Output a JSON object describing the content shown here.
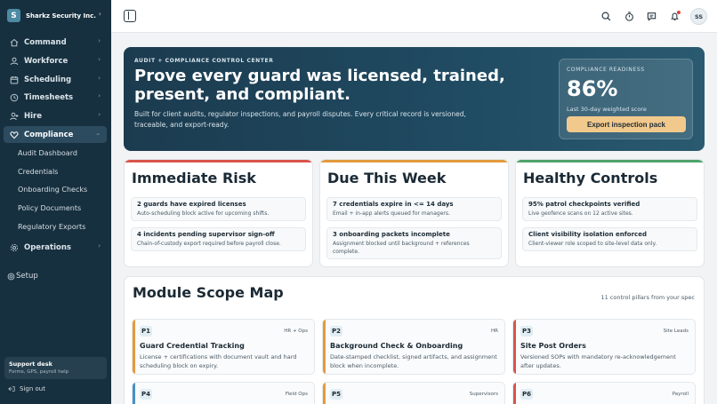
{
  "sidebar": {
    "brand_initial": "S",
    "brand_name": "Sharkz Security Inc.",
    "items": [
      {
        "label": "Command",
        "icon": "home-icon"
      },
      {
        "label": "Workforce",
        "icon": "users-icon"
      },
      {
        "label": "Scheduling",
        "icon": "calendar-icon"
      },
      {
        "label": "Timesheets",
        "icon": "clock-icon"
      },
      {
        "label": "Hire",
        "icon": "user-plus-icon"
      },
      {
        "label": "Compliance",
        "icon": "heart-icon"
      }
    ],
    "compliance_subitems": [
      "Audit Dashboard",
      "Credentials",
      "Onboarding Checks",
      "Policy Documents",
      "Regulatory Exports"
    ],
    "operations_label": "Operations",
    "setup_label": "Setup",
    "support_title": "Support desk",
    "support_sub": "Forms, GPS, payroll help",
    "signout_label": "Sign out"
  },
  "topbar": {
    "avatar_initials": "SS",
    "icons": [
      "search-icon",
      "timer-icon",
      "chat-icon",
      "bell-icon"
    ]
  },
  "hero": {
    "kicker": "AUDIT + COMPLIANCE CONTROL CENTER",
    "title": "Prove every guard was licensed, trained, present, and compliant.",
    "description": "Built for client audits, regulator inspections, and payroll disputes. Every critical record is versioned, traceable, and export-ready.",
    "readiness_label": "COMPLIANCE READINESS",
    "readiness_value": "86%",
    "readiness_sub": "Last 30-day weighted score",
    "export_label": "Export inspection pack"
  },
  "status_cards": [
    {
      "title": "Immediate Risk",
      "accent": "#d9544a",
      "items": [
        {
          "title": "2 guards have expired licenses",
          "desc": "Auto-scheduling block active for upcoming shifts."
        },
        {
          "title": "4 incidents pending supervisor sign-off",
          "desc": "Chain-of-custody export required before payroll close."
        }
      ]
    },
    {
      "title": "Due This Week",
      "accent": "#e39a3e",
      "items": [
        {
          "title": "7 credentials expire in <= 14 days",
          "desc": "Email + in-app alerts queued for managers."
        },
        {
          "title": "3 onboarding packets incomplete",
          "desc": "Assignment blocked until background + references complete."
        }
      ]
    },
    {
      "title": "Healthy Controls",
      "accent": "#4fa36a",
      "items": [
        {
          "title": "95% patrol checkpoints verified",
          "desc": "Live geofence scans on 12 active sites."
        },
        {
          "title": "Client visibility isolation enforced",
          "desc": "Client-viewer role scoped to site-level data only."
        }
      ]
    }
  ],
  "module_map": {
    "title": "Module Scope Map",
    "count_label": "11 control pillars from your spec",
    "cards": [
      {
        "id": "P1",
        "owner": "HR + Ops",
        "accent": "#e39a3e",
        "title": "Guard Credential Tracking",
        "desc": "License + certifications with document vault and hard scheduling block on expiry."
      },
      {
        "id": "P2",
        "owner": "HR",
        "accent": "#e39a3e",
        "title": "Background Check & Onboarding",
        "desc": "Date-stamped checklist, signed artifacts, and assignment block when incomplete."
      },
      {
        "id": "P3",
        "owner": "Site Leads",
        "accent": "#d9544a",
        "title": "Site Post Orders",
        "desc": "Versioned SOPs with mandatory re-acknowledgement after updates."
      },
      {
        "id": "P4",
        "owner": "Field Ops",
        "accent": "#4a90c8",
        "title": "",
        "desc": ""
      },
      {
        "id": "P5",
        "owner": "Supervisors",
        "accent": "#e39a3e",
        "title": "",
        "desc": ""
      },
      {
        "id": "P6",
        "owner": "Payroll",
        "accent": "#d9544a",
        "title": "",
        "desc": ""
      }
    ]
  }
}
